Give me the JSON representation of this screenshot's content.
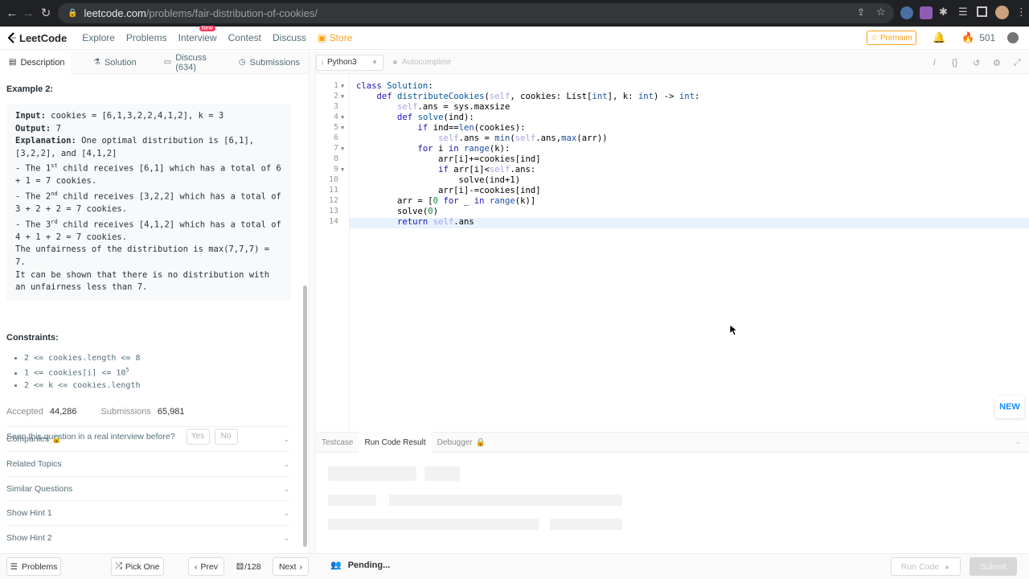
{
  "browser": {
    "url_host": "leetcode.com",
    "url_path": "/problems/fair-distribution-of-cookies/"
  },
  "header": {
    "logo": "LeetCode",
    "nav": [
      "Explore",
      "Problems",
      "Interview",
      "Contest",
      "Discuss"
    ],
    "new_badge": "New",
    "store": "Store",
    "premium": "☆ Premium",
    "points": "501"
  },
  "left_tabs": {
    "description": "Description",
    "solution": "Solution",
    "discuss": "Discuss (634)",
    "submissions": "Submissions"
  },
  "example": {
    "heading": "Example 2:",
    "input_label": "Input:",
    "input_value": " cookies = [6,1,3,2,2,4,1,2], k = 3",
    "output_label": "Output:",
    "output_value": " 7",
    "explanation_label": "Explanation:",
    "explanation_text": " One optimal distribution is [6,1], [3,2,2], and [4,1,2]",
    "l1a": "- The 1",
    "l1sup": "st",
    "l1b": " child receives [6,1] which has a total of 6 + 1 = 7 cookies.",
    "l2a": "- The 2",
    "l2sup": "nd",
    "l2b": " child receives [3,2,2] which has a total of 3 + 2 + 2 = 7 cookies.",
    "l3a": "- The 3",
    "l3sup": "rd",
    "l3b": " child receives [4,1,2] which has a total of 4 + 1 + 2 = 7 cookies.",
    "l4": "The unfairness of the distribution is max(7,7,7) = 7.",
    "l5": "It can be shown that there is no distribution with an unfairness less than 7."
  },
  "constraints": {
    "heading": "Constraints:",
    "c1": "2 <= cookies.length <= 8",
    "c2a": "1 <= cookies[i] <= 10",
    "c2sup": "5",
    "c3": "2 <= k <= cookies.length"
  },
  "stats": {
    "accepted_label": "Accepted",
    "accepted_value": "44,286",
    "submissions_label": "Submissions",
    "submissions_value": "65,981"
  },
  "seen": {
    "question": "Seen this question in a real interview before?",
    "yes": "Yes",
    "no": "No"
  },
  "accordions": [
    "Companies",
    "Related Topics",
    "Similar Questions",
    "Show Hint 1",
    "Show Hint 2"
  ],
  "editor": {
    "language": "Python3",
    "autocomplete": "Autocomplete",
    "line_numbers": [
      "1",
      "2",
      "3",
      "4",
      "5",
      "6",
      "7",
      "8",
      "9",
      "10",
      "11",
      "12",
      "13",
      "14"
    ]
  },
  "new_badge": "NEW",
  "console_tabs": {
    "testcase": "Testcase",
    "run_result": "Run Code Result",
    "debugger": "Debugger"
  },
  "footer": {
    "problems": "Problems",
    "pick_one": "Pick One",
    "prev": "Prev",
    "page": "/128",
    "next": "Next",
    "pending": "Pending...",
    "run_code": "Run Code",
    "submit": "Submit"
  },
  "colors": {
    "brand_orange": "#ffa116",
    "keyword_blue": "#1d12b8",
    "link_blue": "#1a90ff"
  }
}
